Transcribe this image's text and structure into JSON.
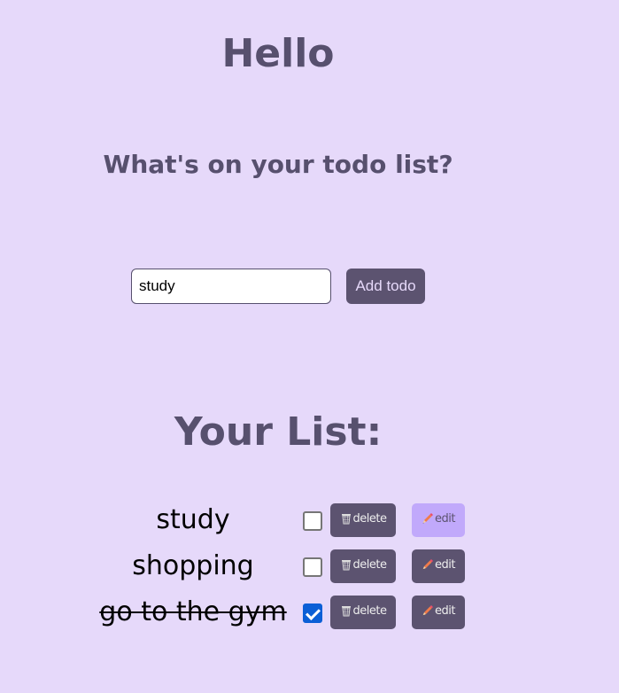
{
  "header": {
    "greeting": "Hello",
    "subtitle": "What's on your todo list?"
  },
  "form": {
    "input_value": "study",
    "add_button_label": "Add todo"
  },
  "list": {
    "title": "Your List:",
    "items": [
      {
        "text": "study",
        "done": false,
        "delete_label": "delete",
        "edit_label": "edit"
      },
      {
        "text": "shopping",
        "done": false,
        "delete_label": "delete",
        "edit_label": "edit"
      },
      {
        "text": "go to the gym",
        "done": true,
        "delete_label": "delete",
        "edit_label": "edit"
      }
    ]
  },
  "icons": {
    "delete": "wastebasket-icon",
    "edit": "pencil-icon"
  },
  "colors": {
    "background": "#e6d9fa",
    "heading": "#57506e",
    "button": "#5c5370",
    "button_hover": "#c1a9fb",
    "checkbox_checked": "#0b5fd6"
  }
}
